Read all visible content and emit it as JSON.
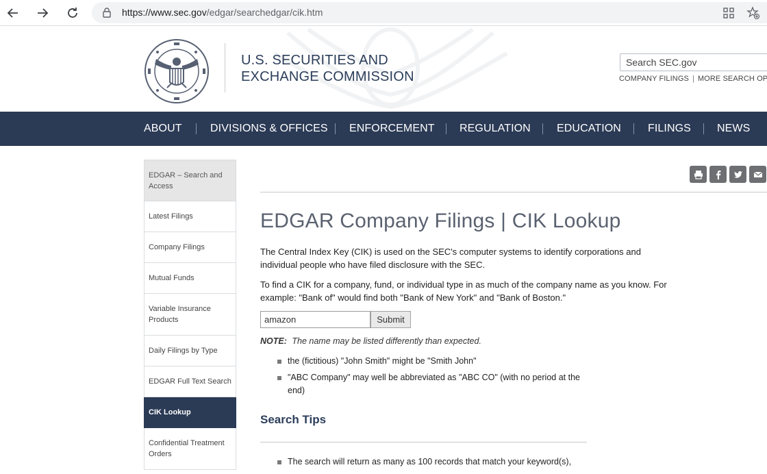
{
  "browser": {
    "url_prefix": "https://www.sec.gov",
    "url_path": "/edgar/searchedgar/cik.htm"
  },
  "header": {
    "agency_line1": "U.S. SECURITIES AND",
    "agency_line2": "EXCHANGE COMMISSION",
    "search_placeholder": "Search SEC.gov",
    "link_company_filings": "COMPANY FILINGS",
    "link_more_search": "MORE SEARCH OPTIONS"
  },
  "nav": {
    "items": [
      "ABOUT",
      "DIVISIONS & OFFICES",
      "ENFORCEMENT",
      "REGULATION",
      "EDUCATION",
      "FILINGS",
      "NEWS"
    ]
  },
  "sidebar": {
    "items": [
      "EDGAR – Search and Access",
      "Latest Filings",
      "Company Filings",
      "Mutual Funds",
      "Variable Insurance Products",
      "Daily Filings by Type",
      "EDGAR Full Text Search",
      "CIK Lookup",
      "Confidential Treatment Orders"
    ],
    "active_index": 7
  },
  "content": {
    "title": "EDGAR Company Filings | CIK Lookup",
    "intro": "The Central Index Key (CIK) is used on the SEC's computer systems to identify corporations and individual people who have filed disclosure with the SEC.",
    "instructions": "To find a CIK for a company, fund, or individual type in as much of the company name as you know. For example: \"Bank of\" would find both \"Bank of New York\" and \"Bank of Boston.\"",
    "input_value": "amazon",
    "submit_label": "Submit",
    "note_label": "NOTE:",
    "note_text": "The name may be listed differently than expected.",
    "note_bullets": [
      "the (fictitious) \"John Smith\" might be \"Smith John\"",
      "\"ABC Company\" may well be abbreviated as \"ABC CO\" (with no period at the end)"
    ],
    "tips_heading": "Search Tips",
    "tips_bullets": [
      "The search will return as many as 100 records that match your keyword(s),"
    ]
  }
}
